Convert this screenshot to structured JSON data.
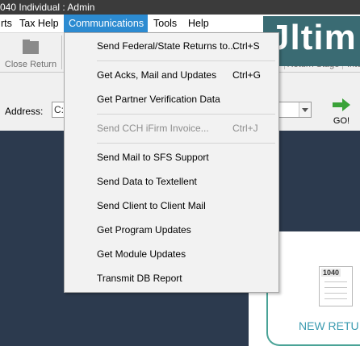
{
  "title": "040 Individual : Admin",
  "menubar": {
    "items": [
      {
        "label": "rts"
      },
      {
        "label": "Tax Help"
      },
      {
        "label": "Communications"
      },
      {
        "label": "Tools"
      },
      {
        "label": "Help"
      }
    ]
  },
  "toolbar": {
    "close_return": "Close Return",
    "return_stage": "Return Stage",
    "inte": "Inte"
  },
  "address": {
    "label": "Address:",
    "value": "C:"
  },
  "go_label": "GO!",
  "banner": {
    "text": "Jltim"
  },
  "new_return": {
    "form_tag": "1040",
    "label": "NEW RETU"
  },
  "communications_menu": {
    "items": [
      {
        "label": "Send Federal/State Returns to...",
        "shortcut": "Ctrl+S",
        "enabled": true
      },
      {
        "label": "Get Acks, Mail and Updates",
        "shortcut": "Ctrl+G",
        "enabled": true
      },
      {
        "label": "Get Partner Verification Data",
        "shortcut": "",
        "enabled": true
      },
      {
        "label": "Send CCH iFirm Invoice...",
        "shortcut": "Ctrl+J",
        "enabled": false
      },
      {
        "label": "Send Mail to SFS Support",
        "shortcut": "",
        "enabled": true
      },
      {
        "label": "Send Data to Textellent",
        "shortcut": "",
        "enabled": true
      },
      {
        "label": "Send Client to Client Mail",
        "shortcut": "",
        "enabled": true
      },
      {
        "label": "Get Program Updates",
        "shortcut": "",
        "enabled": true
      },
      {
        "label": "Get Module Updates",
        "shortcut": "",
        "enabled": true
      },
      {
        "label": "Transmit DB Report",
        "shortcut": "",
        "enabled": true
      }
    ]
  },
  "colors": {
    "titlebar": "#3b3b3b",
    "menu_active": "#2c8bd1",
    "banner_dark": "#2c3a4e",
    "accent_teal": "#4aa397",
    "go_green": "#3aa238"
  }
}
